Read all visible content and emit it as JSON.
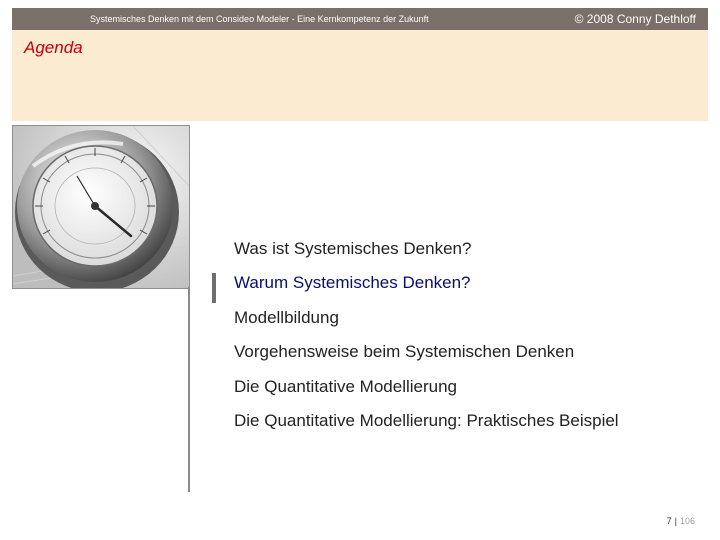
{
  "header": {
    "doc_title": "Systemisches Denken mit dem Consideo Modeler - Eine Kernkompetenz der Zukunft",
    "copyright": "© 2008 Conny Dethloff"
  },
  "slide": {
    "title": "Agenda",
    "items": [
      "Was ist Systemisches Denken?",
      "Warum Systemisches Denken?",
      "Modellbildung",
      "Vorgehensweise beim Systemischen Denken",
      "Die Quantitative Modellierung",
      "Die Quantitative Modellierung: Praktisches Beispiel"
    ],
    "active_index": 1
  },
  "footer": {
    "page": "7",
    "separator": "|",
    "total": "106"
  },
  "colors": {
    "header_bar": "#7a7069",
    "title_band": "#fbebd0",
    "title_text": "#c8000a",
    "active_item": "#0a0f6e"
  }
}
